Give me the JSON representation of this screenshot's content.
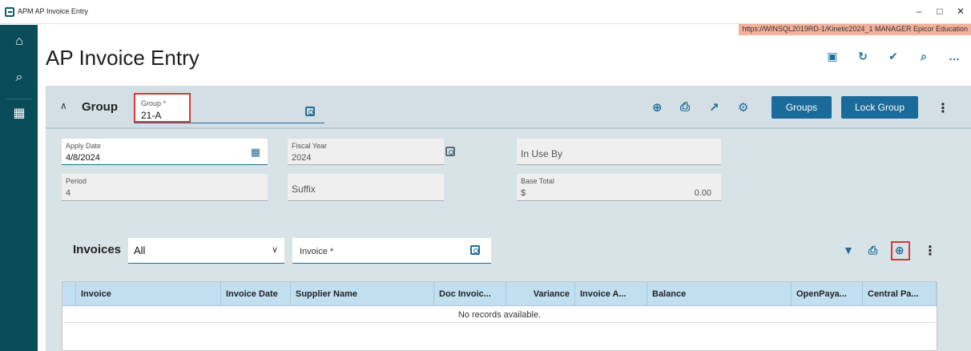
{
  "window": {
    "title": "APM AP Invoice Entry",
    "controls": [
      "–",
      "□",
      "✕"
    ],
    "environment": "https://WINSQL2019RD-1/Kinetic2024_1  MANAGER  Epicor Education"
  },
  "leftnav": {
    "items": [
      {
        "icon": "home-icon",
        "glyph": "⌂"
      },
      {
        "icon": "search-icon",
        "glyph": "⌕"
      },
      {
        "icon": "apps-grid-icon",
        "glyph": "▦"
      }
    ]
  },
  "page": {
    "title": "AP Invoice Entry",
    "actions": [
      {
        "icon": "save-icon",
        "glyph": "▣"
      },
      {
        "icon": "refresh-icon",
        "glyph": "↻"
      },
      {
        "icon": "clear-icon",
        "glyph": "✔"
      },
      {
        "icon": "search-icon",
        "glyph": "⌕"
      },
      {
        "icon": "more-icon",
        "glyph": "…"
      }
    ]
  },
  "group": {
    "label": "Group",
    "field_label": "Group *",
    "field_value": "21-A",
    "toolbar_icons": [
      {
        "icon": "add-circle-icon",
        "glyph": "⊕"
      },
      {
        "icon": "print-icon",
        "glyph": "⎙"
      },
      {
        "icon": "open-external-icon",
        "glyph": "↗"
      },
      {
        "icon": "settings-icon",
        "glyph": "⚙"
      }
    ],
    "groups_button": "Groups",
    "lock_group_button": "Lock Group",
    "kebab": "⋮"
  },
  "fields": {
    "apply_date": {
      "label": "Apply Date",
      "value": "4/8/2024"
    },
    "fiscal_year": {
      "label": "Fiscal Year",
      "value": "2024"
    },
    "in_use_by": {
      "placeholder": "In Use By"
    },
    "period": {
      "label": "Period",
      "value": "4"
    },
    "suffix": {
      "placeholder": "Suffix"
    },
    "base_total": {
      "label": "Base Total",
      "currency": "$",
      "value": "0.00"
    }
  },
  "invoices": {
    "label": "Invoices",
    "filter_value": "All",
    "search_placeholder": "Invoice *",
    "toolbar_icons": [
      {
        "icon": "filter-icon",
        "glyph": "▼"
      },
      {
        "icon": "print-icon",
        "glyph": "⎙"
      },
      {
        "icon": "add-circle-icon",
        "glyph": "⊕"
      },
      {
        "icon": "more-vertical-icon",
        "glyph": "⋮"
      }
    ],
    "columns": [
      "Invoice",
      "Invoice Date",
      "Supplier Name",
      "Doc Invoic...",
      "Variance",
      "Invoice A...",
      "Balance",
      "OpenPaya...",
      "Central Pa..."
    ],
    "empty_message": "No records available."
  },
  "colors": {
    "nav_bg": "#0b4c5a",
    "accent": "#1a6a9a",
    "highlight": "#d9373a",
    "panel_bg": "#d8e3e8",
    "grid_header": "#c2dff0"
  }
}
